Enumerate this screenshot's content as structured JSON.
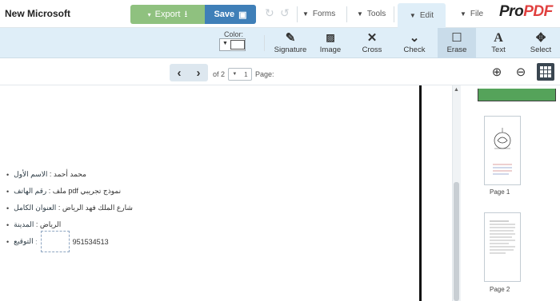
{
  "app": {
    "doc_title": "New Microsoft",
    "logo_a": "PDF",
    "logo_b": "Pro"
  },
  "toolbar": {
    "export_label": "Export",
    "save_label": "Save",
    "undo_icon": "undo-icon",
    "redo_icon": "redo-icon"
  },
  "menus": {
    "forms": "Forms",
    "tools": "Tools",
    "edit": "Edit",
    "file": "File"
  },
  "ribbon": {
    "color_label": "Color:",
    "tools": [
      {
        "label": "Signature",
        "icon": "signature-icon"
      },
      {
        "label": "Image",
        "icon": "image-icon"
      },
      {
        "label": "Cross",
        "icon": "cross-icon"
      },
      {
        "label": "Check",
        "icon": "check-icon"
      },
      {
        "label": "Erase",
        "icon": "erase-icon"
      },
      {
        "label": "Text",
        "icon": "text-icon"
      },
      {
        "label": "Select",
        "icon": "move-icon"
      }
    ]
  },
  "nav": {
    "page_label": "Page:",
    "page_value": "1",
    "of_label": "of 2"
  },
  "document": {
    "fields": [
      {
        "label": "ﺍﻟﺎﺳﻢ ﺍﻟﺄﻭﻝ",
        "value": ": ﻣﺤﻤﺪ ﺃﺣﻤﺪ"
      },
      {
        "label": "ﺭﻗﻢ ﺍﻟﻬﺎﺗﻒ",
        "value": ": ﻣﻠﻒ pdf ﻧﻤﻮﺫﺝ ﺗﺠﺮﻳﺒﻲ"
      },
      {
        "label": "ﺍﻟﻌﻨﻮﺍﻥ ﺍﻟﻜﺎﻣﻞ",
        "value": ": ﺷﺎﺭﻉ ﺍﻟﻤﻠﻚ ﻓﻬﺪ ﺍﻟﺮﻳﺎﺽ"
      },
      {
        "label": "ﺍﻟﻤﺪﻳﻨﺔ",
        "value": ": ﺍﻟﺮﻳﺎﺽ"
      },
      {
        "label": "ﺍﻟﺘﻮﻗﻴﻊ",
        "value": "951534513"
      }
    ]
  },
  "thumbnails": [
    {
      "label": "Page 1"
    },
    {
      "label": "Page 2"
    }
  ],
  "colors": {
    "save": "#3f7fb8",
    "export": "#8fc17f",
    "ribbon": "#dfeef8",
    "current_page": "#55a35a"
  }
}
